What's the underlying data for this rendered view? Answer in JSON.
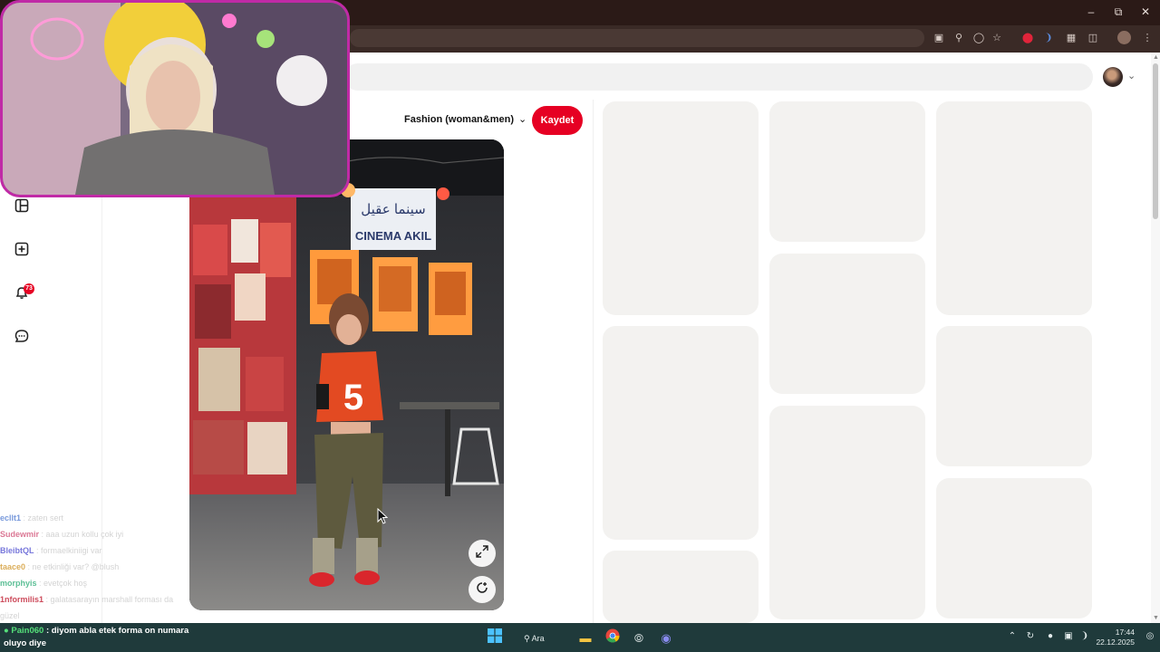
{
  "window": {
    "minimize_icon": "minimize-icon",
    "maximize_icon": "restore-icon",
    "close_icon": "close-icon"
  },
  "toolbar_icons": [
    "screen-cast-icon",
    "password-key-icon",
    "eye-off-icon",
    "star-bookmark-icon",
    "record-icon",
    "audio-icon",
    "extension-badge-icon",
    "puzzle-extensions-icon",
    "profile-icon",
    "kebab-menu-icon"
  ],
  "board_selector": {
    "label": "Fashion (woman&men)"
  },
  "save_button": {
    "label": "Kaydet"
  },
  "notifications": {
    "badge": "73"
  },
  "rail_icons": [
    "boards-icon",
    "create-icon",
    "bell-icon",
    "messages-icon"
  ],
  "pin_signage": {
    "arabic": "سينما عقيل",
    "latin": "CINEMA AKIL",
    "jersey_number": "5"
  },
  "chat": [
    {
      "user": "ecllt1",
      "message": ": zaten sert",
      "color": "#6a8fd8"
    },
    {
      "user": "Sudewmir",
      "message": ": aaa uzun kollu çok iyi",
      "color": "#d86a8a"
    },
    {
      "user": "BleibtQL",
      "message": ": formaelkiniigi var",
      "color": "#6a6ad8"
    },
    {
      "user": "taace0",
      "message": ": ne etkinliği var? @blush",
      "color": "#d8a64a"
    },
    {
      "user": "morphyis",
      "message": ": evetçok hoş",
      "color": "#4ab88a"
    },
    {
      "user": "1nformilis1",
      "message": ": galatasarayın marshall forması da",
      "color": "#c8384a"
    }
  ],
  "chat_wrap": "güzel",
  "stream_notification": {
    "user": "Pain060",
    "message": ": diyom abla etek forma on numara",
    "line2": "oluyo diye"
  },
  "taskbar": {
    "search_label": "Ara",
    "time": "17:44",
    "date": "22.12.2025",
    "apps": [
      "windows-start-icon",
      "search-icon",
      "file-explorer-icon",
      "chrome-icon",
      "obs-icon",
      "discord-icon"
    ]
  },
  "colors": {
    "accent": "#e60023",
    "taskbar": "#1f3a3b",
    "webcam_border": "#c02aa6"
  }
}
